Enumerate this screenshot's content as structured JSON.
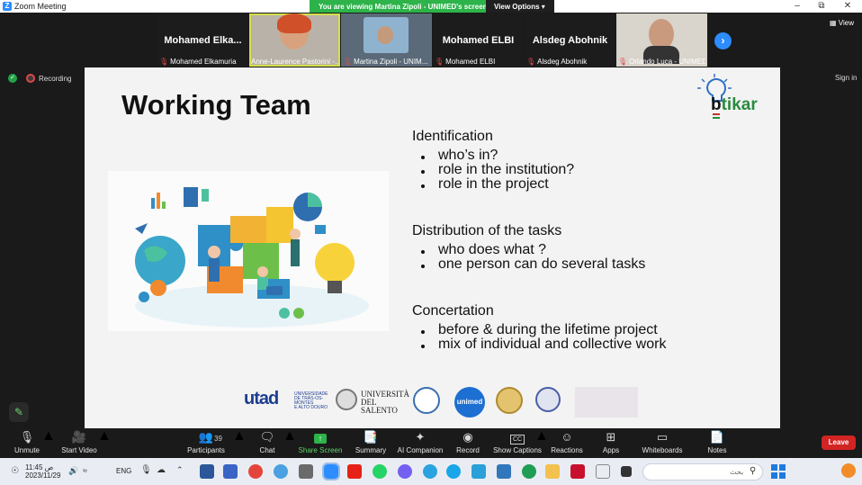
{
  "window": {
    "title": "Zoom Meeting",
    "app_icon": "zoom-logo-icon"
  },
  "banner": {
    "text": "You are viewing Martina Zipoli - UNIMED's screen",
    "view_options": "View Options",
    "color": "#2db34a"
  },
  "participants": [
    {
      "big_name": "Mohamed  Elka...",
      "caption": "Mohamed Elkamuria",
      "video": false
    },
    {
      "big_name": "",
      "caption": "Anne-Laurence Pastorini -...",
      "video": true,
      "active": true
    },
    {
      "big_name": "",
      "caption": "Martina Zipoli - UNIM...",
      "video": true
    },
    {
      "big_name": "Mohamed ELBI",
      "caption": "Mohamed ELBI",
      "video": false
    },
    {
      "big_name": "Alsdeg Abohnik",
      "caption": "Alsdeg Abohnik",
      "video": false
    },
    {
      "big_name": "",
      "caption": "Orlando Luca - UNIMED",
      "video": true
    }
  ],
  "view_label": "View",
  "recording_label": "Recording",
  "sign_in": "Sign in",
  "slide": {
    "title": "Working Team",
    "logo": {
      "first": "b",
      "rest": "tikar"
    },
    "sections": [
      {
        "heading": "Identification",
        "items": [
          "who’s in?",
          "role in the institution?",
          "role in the project"
        ]
      },
      {
        "heading": "Distribution of the tasks",
        "items": [
          "who does what ?",
          "one person can do several tasks"
        ]
      },
      {
        "heading": "Concertation",
        "items": [
          "before & during the lifetime project",
          "mix of individual and collective work"
        ]
      }
    ],
    "partners": {
      "utad": "utad",
      "utad_sub": [
        "UNIVERSIDADE",
        "DE TRÁS-OS-MONTES",
        "E ALTO DOURO"
      ],
      "salento": [
        "UNIVERSITÀ",
        "DEL SALENTO"
      ],
      "unimed": "unimed"
    }
  },
  "toolbar": {
    "unmute": "Unmute",
    "start_video": "Start Video",
    "participants": "Participants",
    "participant_count": "39",
    "chat": "Chat",
    "share_screen": "Share Screen",
    "summary": "Summary",
    "ai_companion": "AI Companion",
    "record": "Record",
    "show_captions": "Show Captions",
    "reactions": "Reactions",
    "apps": "Apps",
    "whiteboards": "Whiteboards",
    "notes": "Notes",
    "leave": "Leave",
    "captions_glyph": "CC"
  },
  "taskbar": {
    "time": "11:45 ص",
    "date": "2023/11/29",
    "lang": "ENG",
    "search_placeholder": "بحث"
  }
}
